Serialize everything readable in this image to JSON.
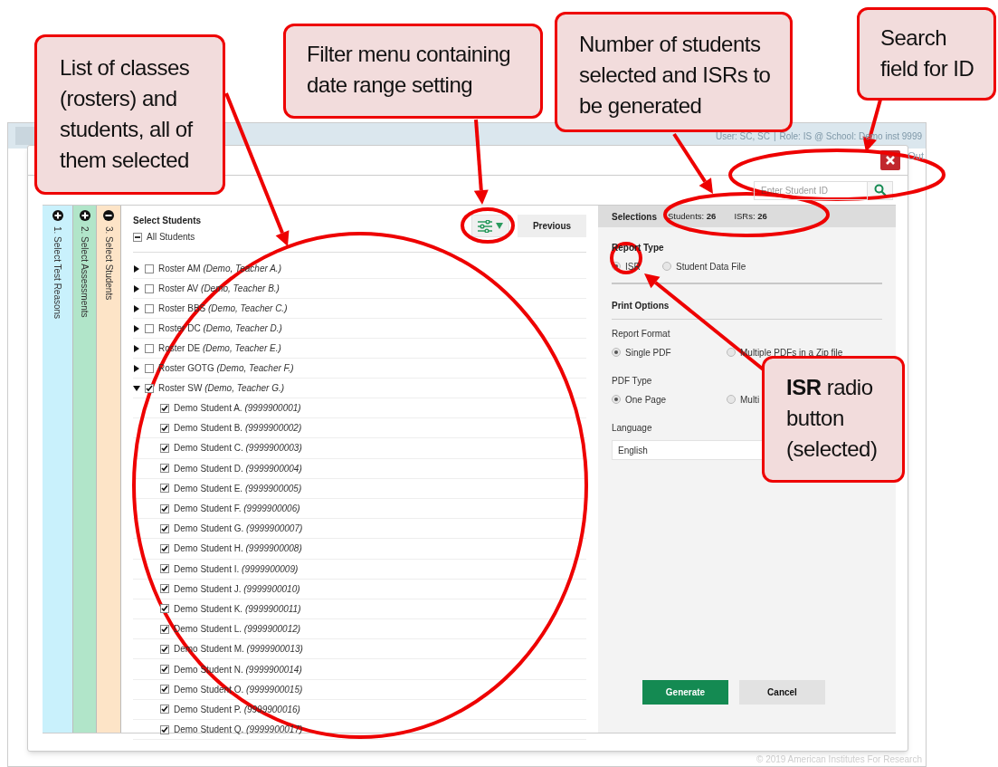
{
  "background_app": {
    "user": "User: SC, SC",
    "separator": "|",
    "role": "Role: IS @ School: Demo inst 9999",
    "logout": "Out",
    "footer": "© 2019 American Institutes For Research"
  },
  "steps": [
    {
      "label": "1. Select Test Reasons",
      "expanded": false,
      "color": "#c9f1fc"
    },
    {
      "label": "2. Select Assessments",
      "expanded": false,
      "color": "#b1e5c9"
    },
    {
      "label": "3. Select Students",
      "expanded": true,
      "color": "#fde4c7"
    }
  ],
  "search": {
    "placeholder": "Enter Student ID"
  },
  "select_students": {
    "title": "Select Students",
    "all_label": "All Students",
    "all_indeterminate": true
  },
  "previous_button": "Previous",
  "rosters": [
    {
      "label": "Roster AM *(Demo, Teacher A.)*",
      "expanded": false,
      "checked": false
    },
    {
      "label": "Roster AV *(Demo, Teacher B.)*",
      "expanded": false,
      "checked": false
    },
    {
      "label": "Roster BBS *(Demo, Teacher C.)*",
      "expanded": false,
      "checked": false
    },
    {
      "label": "Roster DC *(Demo, Teacher D.)*",
      "expanded": false,
      "checked": false
    },
    {
      "label": "Roster DE *(Demo, Teacher E.)*",
      "expanded": false,
      "checked": false
    },
    {
      "label": "Roster GOTG *(Demo, Teacher F.)*",
      "expanded": false,
      "checked": false
    },
    {
      "label": "Roster SW *(Demo, Teacher G.)*",
      "expanded": true,
      "checked": true,
      "students": [
        {
          "label": "Demo Student A. *(9999900001)*",
          "checked": true
        },
        {
          "label": "Demo Student B. *(9999900002)*",
          "checked": true
        },
        {
          "label": "Demo Student C. *(9999900003)*",
          "checked": true
        },
        {
          "label": "Demo Student D. *(9999900004)*",
          "checked": true
        },
        {
          "label": "Demo Student E. *(9999900005)*",
          "checked": true
        },
        {
          "label": "Demo Student F. *(9999900006)*",
          "checked": true
        },
        {
          "label": "Demo Student G. *(9999900007)*",
          "checked": true
        },
        {
          "label": "Demo Student H. *(9999900008)*",
          "checked": true
        },
        {
          "label": "Demo Student I. *(9999900009)*",
          "checked": true
        },
        {
          "label": "Demo Student J. *(9999900010)*",
          "checked": true
        },
        {
          "label": "Demo Student K. *(9999900011)*",
          "checked": true
        },
        {
          "label": "Demo Student L. *(9999900012)*",
          "checked": true
        },
        {
          "label": "Demo Student M. *(9999900013)*",
          "checked": true
        },
        {
          "label": "Demo Student N. *(9999900014)*",
          "checked": true
        },
        {
          "label": "Demo Student O. *(9999900015)*",
          "checked": true
        },
        {
          "label": "Demo Student P. *(9999900016)*",
          "checked": true
        },
        {
          "label": "Demo Student Q. *(9999900017)*",
          "checked": true
        }
      ]
    }
  ],
  "selections": {
    "title": "Selections",
    "students_label": "Students:",
    "students": "26",
    "isrs_label": "ISRs:",
    "isrs": "26"
  },
  "report_type": {
    "title": "Report Type",
    "options": [
      {
        "label": "ISR",
        "selected": true
      },
      {
        "label": "Student Data File",
        "selected": false
      }
    ]
  },
  "print_options": {
    "title": "Print Options"
  },
  "report_format": {
    "title": "Report Format",
    "options": [
      {
        "label": "Single PDF",
        "selected": true
      },
      {
        "label": "Multiple PDFs in a Zip file",
        "selected": false
      }
    ]
  },
  "pdf_type": {
    "title": "PDF Type",
    "options": [
      {
        "label": "One Page",
        "selected": true
      },
      {
        "label": "Multi",
        "selected": false
      }
    ]
  },
  "language": {
    "title": "Language",
    "value": "English"
  },
  "buttons": [
    {
      "label": "Generate",
      "kind": "primary"
    },
    {
      "label": "Cancel",
      "kind": "secondary"
    }
  ],
  "callouts": [
    {
      "text": "List of classes (rosters) and students, all of them selected"
    },
    {
      "text": "Filter menu containing date range setting"
    },
    {
      "text": "Number of students selected and ISRs to be generated"
    },
    {
      "text": "Search field for ID"
    },
    {
      "text": "**ISR** radio button (selected)"
    }
  ]
}
